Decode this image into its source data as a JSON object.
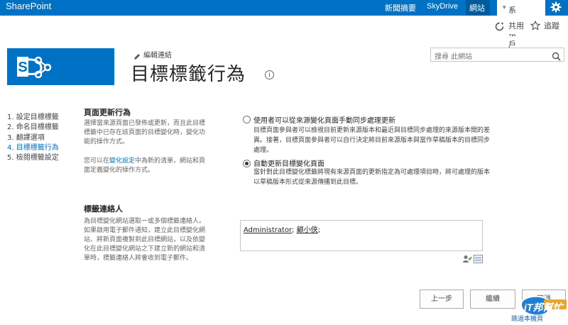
{
  "suite_bar": {
    "brand": "SharePoint",
    "links": [
      "新聞摘要",
      "SkyDrive",
      "網站"
    ],
    "account": "系統帳戶",
    "account_caret": "▾",
    "gear_icon": "gear-icon"
  },
  "ribbon": {
    "share": "共用",
    "follow": "追蹤"
  },
  "header": {
    "edit_links": "編輯連結",
    "title": "目標標籤行為",
    "info_icon": "i",
    "search_placeholder": "搜尋 此網站"
  },
  "steps": [
    "1.  設定目標標籤",
    "2.  命名目標標籤",
    "3.  翻譯選項",
    "4.  目標標籤行為",
    "5.  檢閱標籤設定"
  ],
  "page_update": {
    "heading": "頁面更新行為",
    "desc_lines": [
      "選擇當來源頁面已發佈或更新，而且此目標",
      "標籤中已存在該頁面的目標變化時，變化功",
      "能的操作方式。"
    ],
    "desc2_pre": "您可以在",
    "desc2_link": "變化設定",
    "desc2_post": "中為新的清單，網站和頁",
    "desc2_line2": "面定義變化的操作方式。",
    "option1_label": "使用者可以從來源變化頁面手動同步處理更新",
    "option1_desc": [
      "目標頁面參與者可以檢視目前更新來源版本和最近與目標同步處理的來源版本間的差",
      "異。接著，目標頁面參與者可以自行決定將目前來源版本與當作草稿版本的目標同步",
      "處理。"
    ],
    "option2_label": "自動更新目標變化頁面",
    "option2_desc": [
      "當針對此目標變化標籤將現有來源頁面的更新指定為可處理項目時，將可處理的版本",
      "以草稿版本形式從來源傳播到此目標。"
    ],
    "selected": 2
  },
  "contacts": {
    "heading": "標籤連絡人",
    "desc_lines": [
      "為目標變化網站選取一或多個標籤連絡人。",
      "如果啟用電子郵件通知，建立此目標變化網",
      "站、將新頁面複製到此目標網站，以及依變",
      "化在此目標變化網站之下建立新的網站和清",
      "單時，標籤連絡人將會收到電子郵件。"
    ],
    "people": [
      "Administrator",
      "顧小俠"
    ]
  },
  "buttons": {
    "back": "上一步",
    "next": "繼續",
    "cancel": "取消"
  },
  "watermark": {
    "logo": "iT邦幫忙",
    "text": "跳過本機頁"
  },
  "colors": {
    "accent": "#0072c6",
    "suite_dark": "#005a9e"
  }
}
